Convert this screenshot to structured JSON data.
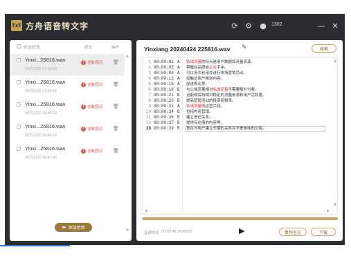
{
  "app": {
    "logo_text": "TxT",
    "title": "方舟语音转文字",
    "user_id": "1302",
    "icons": {
      "refresh": "refresh-icon",
      "settings": "gear-icon",
      "user": "user-icon",
      "minimize": "minimize-icon",
      "close": "close-icon"
    }
  },
  "left": {
    "header": {
      "select_all": "全选/反选",
      "status": "状态",
      "action": "操作"
    },
    "files": [
      {
        "name": "Yinxi...25816.wav",
        "date": "05月31日 17:43:55",
        "status": "含敏感词"
      },
      {
        "name": "Yinxi...25816.wav",
        "date": "05月31日 17:43:55",
        "status": "含敏感词"
      },
      {
        "name": "Yinxi...25816.wav",
        "date": "06月12日 09:46:53",
        "status": "含敏感词"
      },
      {
        "name": "Yinxi...25816.wav",
        "date": "06月12日 09:46:53",
        "status": "含敏感词"
      },
      {
        "name": "Yinxi...25816.wav",
        "date": "06月12日 09:47:40",
        "status": "含敏感词"
      }
    ],
    "add_button": "添加音频"
  },
  "right": {
    "title": "Yinxiang 20240424 225816.wav",
    "search_button": "搜索",
    "lines": [
      {
        "num": "1",
        "time": "00:00:01",
        "speaker": "A",
        "pre": "",
        "hl": "私域流量",
        "post": "的特点是用户数据和流量资源。"
      },
      {
        "num": "2",
        "time": "00:00:05",
        "speaker": "A",
        "pre": "掌握在品牌或",
        "hl": "企业",
        "post": "手中。"
      },
      {
        "num": "3",
        "time": "00:00:08",
        "speaker": "A",
        "pre": "可以多次利用并进行市场营销活动。",
        "hl": "",
        "post": ""
      },
      {
        "num": "4",
        "time": "00:00:12",
        "speaker": "A",
        "pre": "如触达用户推送内容。",
        "hl": "",
        "post": ""
      },
      {
        "num": "5",
        "time": "00:00:15",
        "speaker": "A",
        "pre": "促进购买等。",
        "hl": "",
        "post": ""
      },
      {
        "num": "6",
        "time": "00:00:16",
        "speaker": "B",
        "pre": "与公域流量相对",
        "hl": "私域流量",
        "post": "不需要额外付费。"
      },
      {
        "num": "7",
        "time": "00:00:21",
        "speaker": "B",
        "pre": "且能够保持相对稳定的流量来源和用户活跃度。",
        "hl": "",
        "post": ""
      },
      {
        "num": "8",
        "time": "00:00:26",
        "speaker": "B",
        "pre": "提高营销活动的投资回报率。",
        "hl": "",
        "post": ""
      },
      {
        "num": "9",
        "time": "00:00:31",
        "speaker": "A",
        "pre": "",
        "hl": "私域流量",
        "post": "的运营手段。"
      },
      {
        "num": "10",
        "time": "00:00:34",
        "speaker": "B",
        "pre": "包括内容营销。",
        "hl": "",
        "post": ""
      },
      {
        "num": "11",
        "time": "00:00:36",
        "speaker": "B",
        "pre": "建立信任关系。",
        "hl": "",
        "post": ""
      },
      {
        "num": "12",
        "time": "00:00:37",
        "speaker": "B",
        "pre": "提供有价值的内容等。",
        "hl": "",
        "post": ""
      },
      {
        "num": "13",
        "time": "00:00:39",
        "speaker": "B",
        "pre": "意在与用户建立长期的关系并不是单纯的交易。",
        "hl": "",
        "post": ""
      }
    ],
    "progress": 1.0,
    "duration_label": "音频时长:",
    "duration_value": "00:00:48.3430000",
    "copy_button": "复制全文",
    "download_button": "下载"
  }
}
